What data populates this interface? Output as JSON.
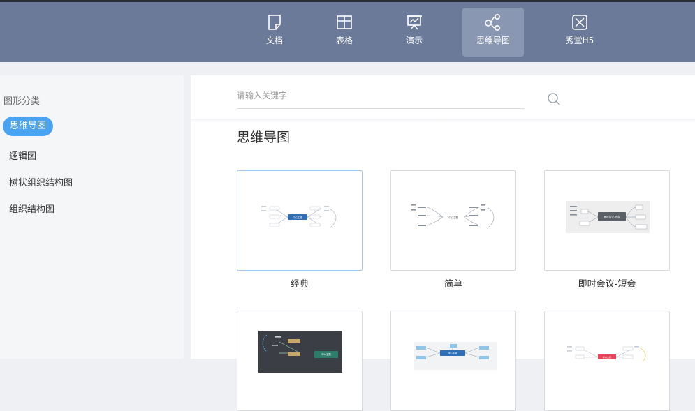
{
  "header": {
    "tabs": [
      {
        "label": "文档",
        "icon": "document-icon"
      },
      {
        "label": "表格",
        "icon": "table-icon"
      },
      {
        "label": "演示",
        "icon": "presentation-icon"
      },
      {
        "label": "思维导图",
        "icon": "mindmap-icon",
        "active": true
      },
      {
        "label": "秀堂H5",
        "icon": "h5-icon"
      }
    ]
  },
  "sidebar": {
    "title": "图形分类",
    "items": [
      {
        "label": "思维导图",
        "active": true
      },
      {
        "label": "逻辑图"
      },
      {
        "label": "树状组织结构图"
      },
      {
        "label": "组织结构图"
      }
    ]
  },
  "search": {
    "placeholder": "请输入关键字",
    "value": ""
  },
  "main": {
    "section_title": "思维导图",
    "templates": [
      {
        "label": "经典",
        "thumb_center": "中心主题"
      },
      {
        "label": "简单",
        "thumb_center": "中心主题"
      },
      {
        "label": "即时会议-短会",
        "thumb_center": "即时会议-短会"
      },
      {
        "label": "",
        "thumb_center": "中心主题"
      },
      {
        "label": "",
        "thumb_center": "中心主题"
      },
      {
        "label": "",
        "thumb_center": "中心主题"
      }
    ]
  },
  "colors": {
    "header_bg": "#6a7a98",
    "tab_active_bg": "#8997b2",
    "accent": "#4aa3f0",
    "classic_center": "#2f6fb5",
    "dark_thumb_bg": "#3b3f45",
    "red_center": "#e8455a"
  }
}
